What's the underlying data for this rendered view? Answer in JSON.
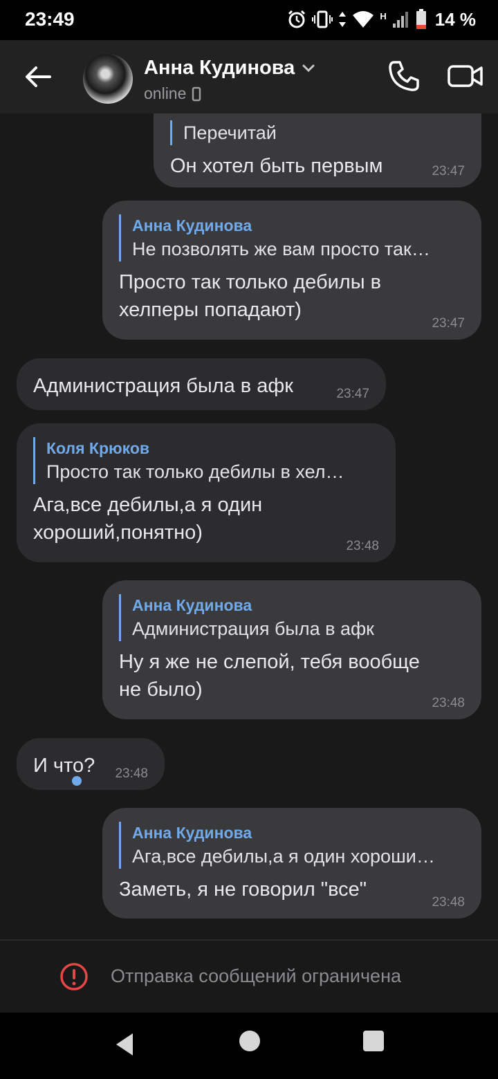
{
  "status_bar": {
    "time": "23:49",
    "battery": "14 %",
    "network": "H",
    "icons": [
      "alarm-icon",
      "vibrate-icon",
      "data-arrows-icon",
      "wifi-icon",
      "signal-icon",
      "battery-low-icon"
    ]
  },
  "header": {
    "contact_name": "Анна Кудинова",
    "status": "online",
    "icons": [
      "back-arrow-icon",
      "chevron-down-icon",
      "phone-icon",
      "video-camera-icon"
    ]
  },
  "messages": [
    {
      "direction": "out",
      "reply_text": "Перечитай",
      "text": "Он хотел быть первым",
      "time": "23:47"
    },
    {
      "direction": "out",
      "reply_author": "Анна Кудинова",
      "reply_text": "Не позволять же вам просто так…",
      "text_lines": [
        "Просто так только дебилы в",
        "хелперы попадают)"
      ],
      "time": "23:47"
    },
    {
      "direction": "in",
      "text": "Администрация была в афк",
      "time": "23:47"
    },
    {
      "direction": "in",
      "reply_author": "Коля Крюков",
      "reply_text": "Просто так только дебилы в хел…",
      "text_lines": [
        "Ага,все дебилы,а я один",
        "хороший,понятно)"
      ],
      "time": "23:48"
    },
    {
      "direction": "out",
      "reply_author": "Анна Кудинова",
      "reply_text": "Администрация была в афк",
      "text_lines": [
        "Ну я же не слепой, тебя вообще",
        "не было)"
      ],
      "time": "23:48"
    },
    {
      "direction": "in",
      "text": "И что?",
      "time": "23:48"
    },
    {
      "direction": "out",
      "reply_author": "Анна Кудинова",
      "reply_text": "Ага,все дебилы,а я один хороши…",
      "text": "Заметь, я не говорил \"все\"",
      "time": "23:48",
      "unread": true
    }
  ],
  "restriction": {
    "text": "Отправка сообщений ограничена",
    "color": "#e64646"
  },
  "colors": {
    "accent": "#71aaeb",
    "background": "#19191a",
    "bubble_out": "#3a3a3c",
    "bubble_in": "#2c2c2e"
  }
}
